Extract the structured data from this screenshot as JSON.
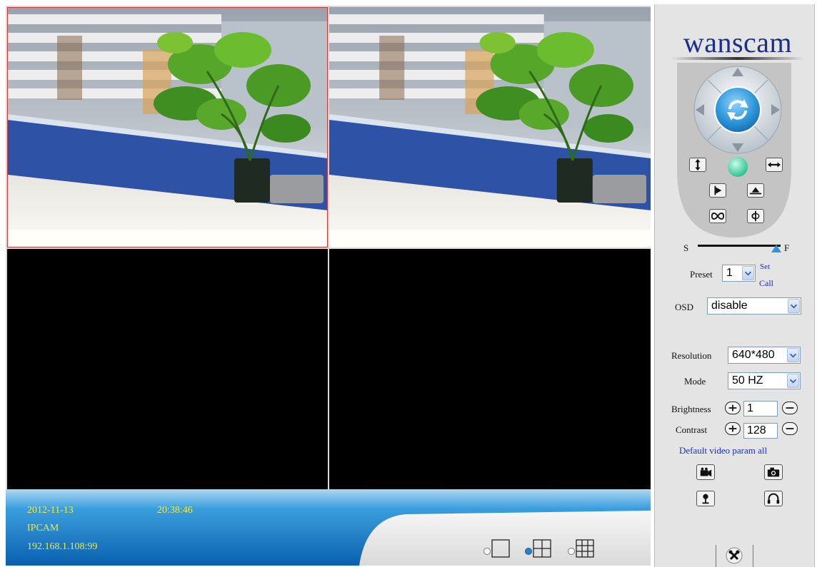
{
  "brand": {
    "logo_text": "wanscam"
  },
  "status": {
    "date": "2012-11-13",
    "time": "20:38:46",
    "device_name": "IPCAM",
    "address": "192.168.1.108:99"
  },
  "ptz": {
    "speed_left": "S",
    "speed_right": "F",
    "speed_level": 0.95
  },
  "preset": {
    "label": "Preset",
    "value": "1",
    "set_label": "Set",
    "call_label": "Call"
  },
  "osd": {
    "label": "OSD",
    "value": "disable"
  },
  "resolution": {
    "label": "Resolution",
    "value": "640*480"
  },
  "mode": {
    "label": "Mode",
    "value": "50 HZ"
  },
  "brightness": {
    "label": "Brightness",
    "value": "1"
  },
  "contrast": {
    "label": "Contrast",
    "value": "128"
  },
  "default_link": "Default video param all",
  "layouts": {
    "options": [
      "1",
      "4",
      "9"
    ],
    "selected": "4"
  },
  "icons": [
    "refresh-icon",
    "vertical-flip-icon",
    "horizontal-flip-icon",
    "patrol-icon",
    "mirror-icon",
    "infinite-patrol-icon",
    "center-icon",
    "record-icon",
    "snapshot-icon",
    "talk-icon",
    "listen-icon",
    "settings-icon"
  ],
  "colors": {
    "accent_blue": "#2e97d9",
    "status_yellow": "#f2e84a",
    "logo_blue": "#1a2f8a"
  }
}
